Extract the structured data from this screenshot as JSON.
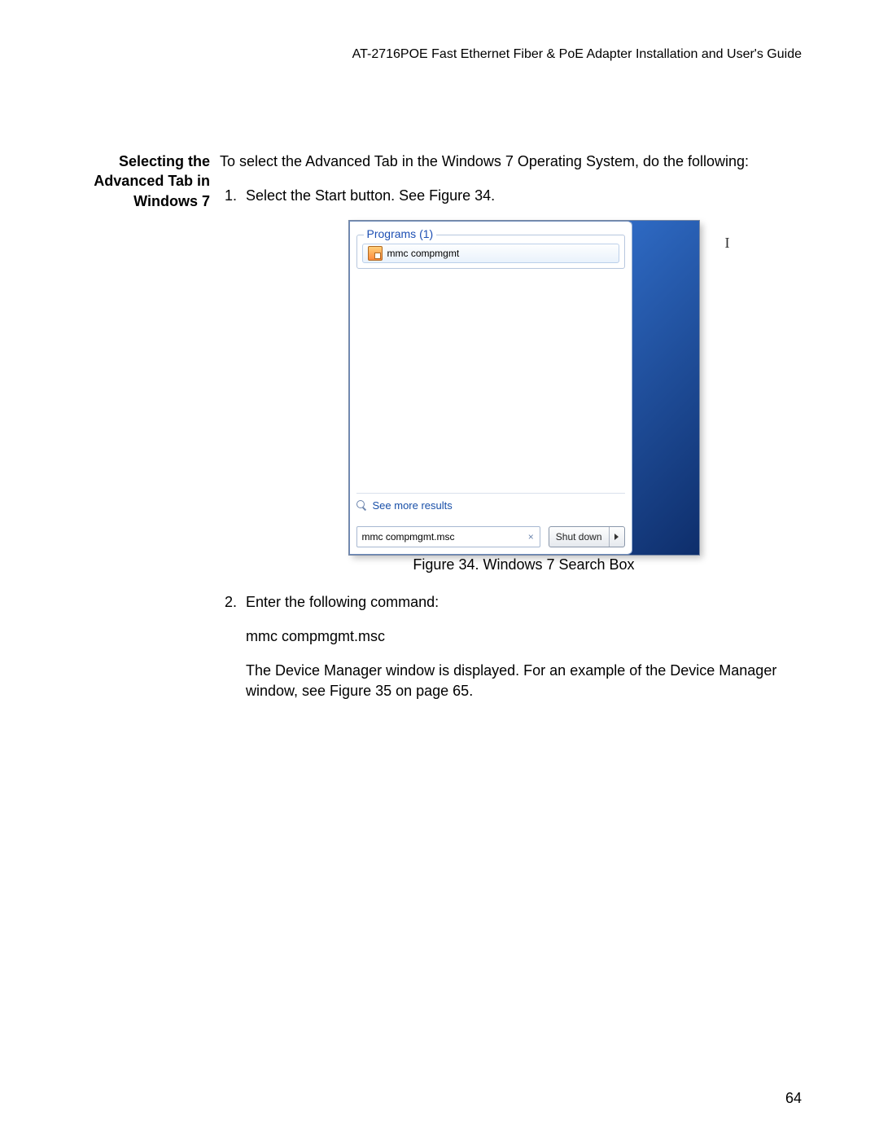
{
  "header": {
    "running_head": "AT-2716POE Fast Ethernet Fiber & PoE Adapter Installation and User's Guide"
  },
  "side_heading": {
    "line1": "Selecting the",
    "line2": "Advanced Tab in",
    "line3": "Windows 7"
  },
  "intro": "To select the Advanced Tab in the Windows 7 Operating System, do the following:",
  "steps": {
    "step1": "Select the Start button. See Figure 34.",
    "step2_intro": "Enter the following command:",
    "step2_cmd": "mmc compmgmt.msc",
    "step2_body": "The Device Manager window is displayed. For an example of the Device Manager window, see Figure 35 on page 65."
  },
  "figure": {
    "caption": "Figure 34. Windows 7 Search Box",
    "programs_label": "Programs (1)",
    "result_text": "mmc compmgmt",
    "see_more": "See more results",
    "search_value": "mmc compmgmt.msc",
    "shutdown_label": "Shut down",
    "clear_label": "×"
  },
  "page_number": "64"
}
